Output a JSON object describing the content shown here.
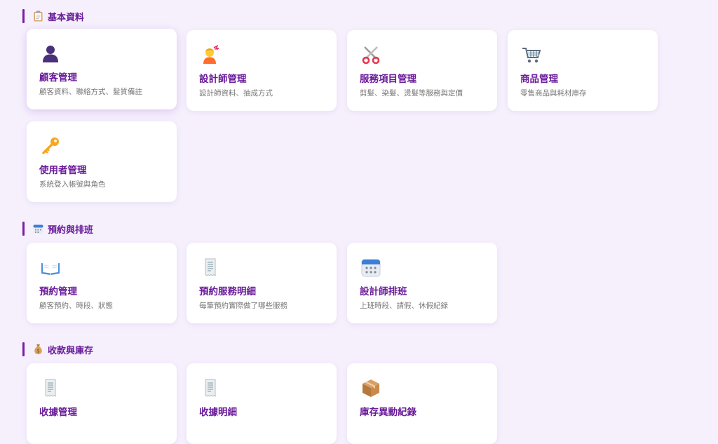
{
  "sections": [
    {
      "title": "基本資料",
      "icon": "clipboard-icon",
      "cards": [
        {
          "title": "顧客管理",
          "desc": "顧客資料、聯絡方式、髮質備註",
          "icon": "person-silhouette-icon"
        },
        {
          "title": "設計師管理",
          "desc": "設計師資料、抽成方式",
          "icon": "haircut-person-icon"
        },
        {
          "title": "服務項目管理",
          "desc": "剪髮、染髮、燙髮等服務與定價",
          "icon": "scissors-icon"
        },
        {
          "title": "商品管理",
          "desc": "零售商品與耗材庫存",
          "icon": "shopping-cart-icon"
        },
        {
          "title": "使用者管理",
          "desc": "系統登入帳號與角色",
          "icon": "key-icon"
        }
      ]
    },
    {
      "title": "預約與排班",
      "icon": "calendar-icon",
      "cards": [
        {
          "title": "預約管理",
          "desc": "顧客預約、時段、狀態",
          "icon": "open-book-icon"
        },
        {
          "title": "預約服務明細",
          "desc": "每筆預約實際做了哪些服務",
          "icon": "receipt-icon"
        },
        {
          "title": "設計師排班",
          "desc": "上班時段、請假、休假紀錄",
          "icon": "calendar-icon"
        }
      ]
    },
    {
      "title": "收款與庫存",
      "icon": "money-bag-icon",
      "cards": [
        {
          "title": "收據管理",
          "desc": "",
          "icon": "receipt-icon"
        },
        {
          "title": "收據明細",
          "desc": "",
          "icon": "receipt-icon"
        },
        {
          "title": "庫存異動紀錄",
          "desc": "",
          "icon": "package-icon"
        }
      ]
    }
  ]
}
